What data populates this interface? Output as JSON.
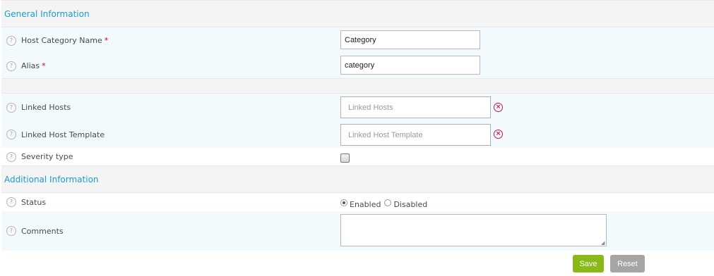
{
  "general": {
    "title": "General Information",
    "host_category_name": {
      "label": "Host Category Name",
      "required": "*",
      "value": "Category"
    },
    "alias": {
      "label": "Alias",
      "required": "*",
      "value": "category"
    }
  },
  "relations": {
    "linked_hosts": {
      "label": "Linked Hosts",
      "placeholder": "Linked Hosts"
    },
    "linked_host_template": {
      "label": "Linked Host Template",
      "placeholder": "Linked Host Template"
    },
    "severity_type": {
      "label": "Severity type",
      "checked": false
    }
  },
  "additional": {
    "title": "Additional Information",
    "status": {
      "label": "Status",
      "options": [
        "Enabled",
        "Disabled"
      ],
      "selected": "Enabled"
    },
    "comments": {
      "label": "Comments",
      "value": ""
    }
  },
  "help_icon_glyph": "?",
  "clear_icon_glyph": "×",
  "buttons": {
    "save": "Save",
    "reset": "Reset"
  },
  "colors": {
    "accent": "#1d9bd1",
    "save": "#88b917",
    "reset": "#a5a5a5",
    "required": "#d0021b",
    "clear": "#d0104c"
  }
}
